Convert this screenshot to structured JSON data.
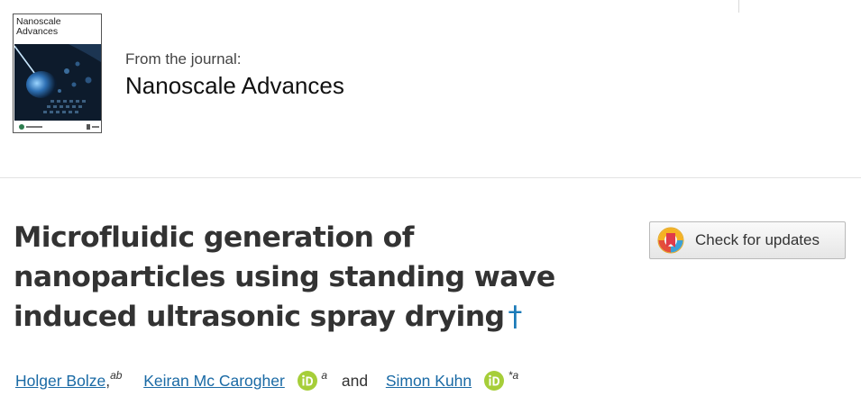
{
  "cover": {
    "title_line1": "Nanoscale",
    "title_line2": "Advances"
  },
  "journal": {
    "from_label": "From the journal:",
    "name": "Nanoscale Advances"
  },
  "article": {
    "title": "Microfluidic generation of nanoparticles using standing wave induced ultrasonic spray drying",
    "dagger": "†"
  },
  "updates_button": {
    "label": "Check for updates",
    "icon": "crossmark-icon"
  },
  "authors": [
    {
      "name": "Holger Bolze",
      "sep": ",",
      "affiliation": "ab",
      "orcid": false
    },
    {
      "name": "Keiran Mc Carogher",
      "affiliation": "a",
      "orcid": true
    },
    {
      "name": "Simon Kuhn",
      "affiliation": "*a",
      "orcid": true
    }
  ],
  "authors_joiner": "and",
  "colors": {
    "link": "#1a6aa5",
    "orcid_green": "#a6ce39",
    "title_text": "#333333"
  }
}
